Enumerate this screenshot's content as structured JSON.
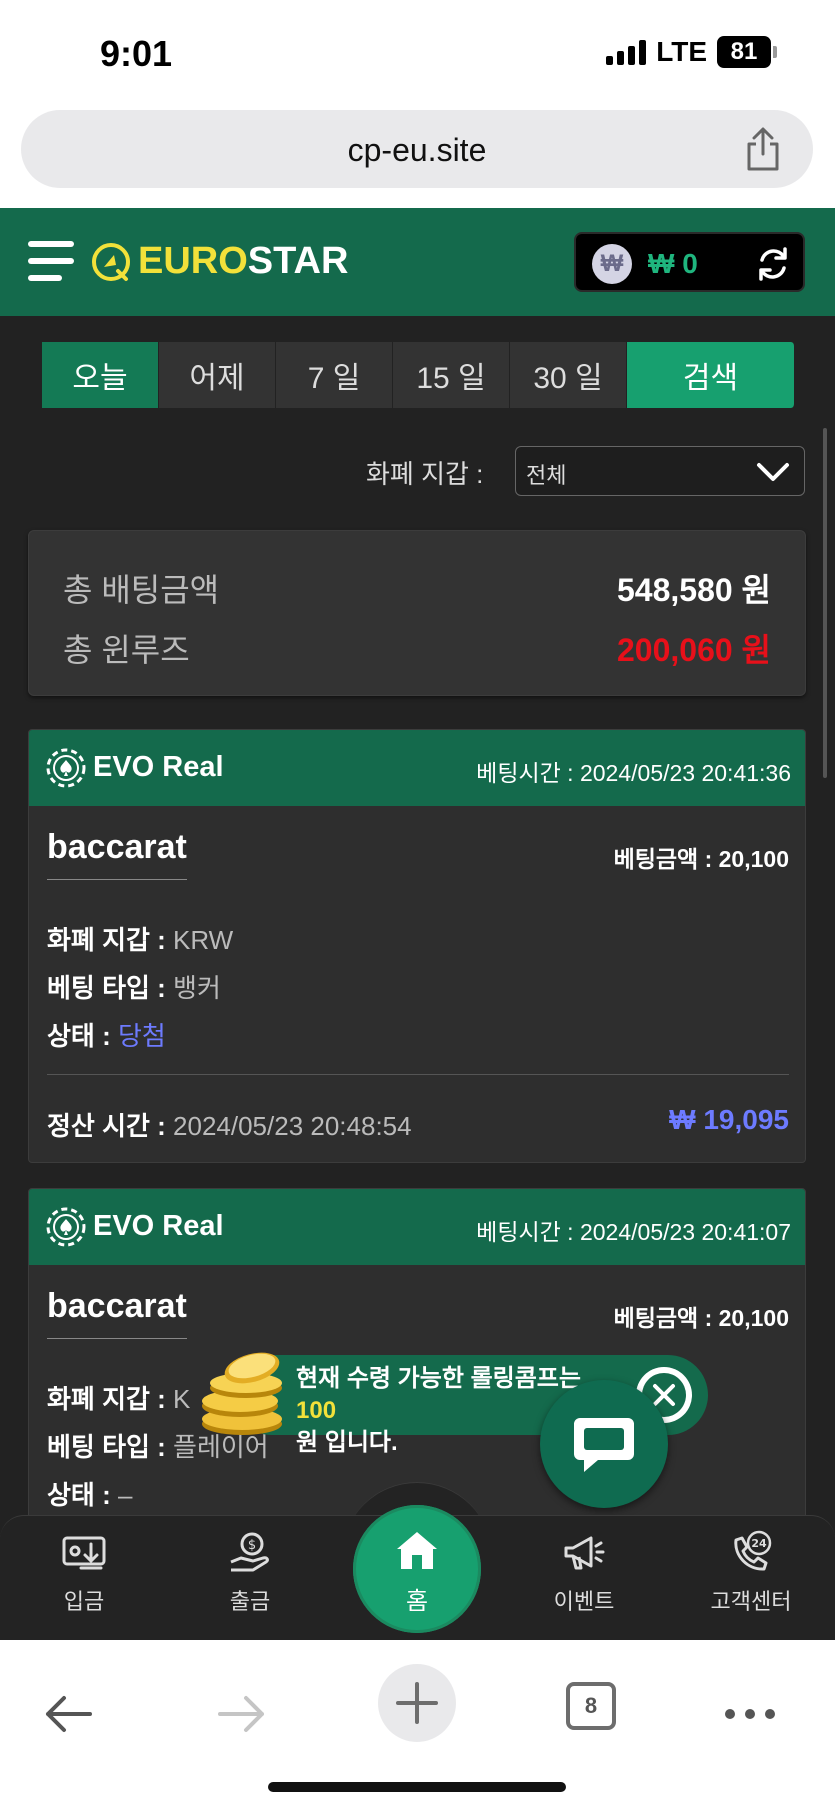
{
  "status_bar": {
    "time": "9:01",
    "network": "LTE",
    "battery": "81"
  },
  "browser": {
    "url": "cp-eu.site",
    "tab_count": "8"
  },
  "header": {
    "logo_part1": "EURO",
    "logo_part2": "STAR",
    "balance": "₩ 0",
    "currency_symbol": "₩"
  },
  "date_tabs": [
    {
      "label": "오늘",
      "active": true
    },
    {
      "label": "어제",
      "active": false
    },
    {
      "label": "7 일",
      "active": false
    },
    {
      "label": "15 일",
      "active": false
    },
    {
      "label": "30 일",
      "active": false
    }
  ],
  "search_label": "검색",
  "filter": {
    "label": "화폐 지갑 :",
    "value": "전체"
  },
  "summary": {
    "total_bet_label": "총 배팅금액",
    "total_bet_value": "548,580 원",
    "total_winloss_label": "총 윈루즈",
    "total_winloss_value": "200,060 원"
  },
  "bets": [
    {
      "provider": "EVO Real",
      "bet_time": "베팅시간 : 2024/05/23 20:41:36",
      "game": "baccarat",
      "bet_amount": "베팅금액 : 20,100",
      "currency_label": "화폐 지갑 :",
      "currency_value": "KRW",
      "type_label": "베팅 타입 :",
      "type_value": "뱅커",
      "status_label": "상태 :",
      "status_value": "당첨",
      "settle_label": "정산 시간 :",
      "settle_value": "2024/05/23 20:48:54",
      "payout": "₩ 19,095"
    },
    {
      "provider": "EVO Real",
      "bet_time": "베팅시간 : 2024/05/23 20:41:07",
      "game": "baccarat",
      "bet_amount": "베팅금액 : 20,100",
      "currency_label": "화폐 지갑 :",
      "currency_value": "K",
      "type_label": "베팅 타입 :",
      "type_value": "플레이어",
      "status_label": "상태 :",
      "status_value": "–"
    }
  ],
  "toast": {
    "line1_prefix": "현재 수령 가능한 롤링콤프는 ",
    "highlight": "100",
    "line2": "원 입니다."
  },
  "bottom_nav": {
    "deposit": "입금",
    "withdraw": "출금",
    "home": "홈",
    "event": "이벤트",
    "support": "고객센터"
  },
  "colors": {
    "header_green": "#146a4c",
    "accent_green": "#17a06f",
    "loss_red": "#e8101a",
    "win_blue": "#6d7bff",
    "logo_yellow": "#f2e13a"
  }
}
